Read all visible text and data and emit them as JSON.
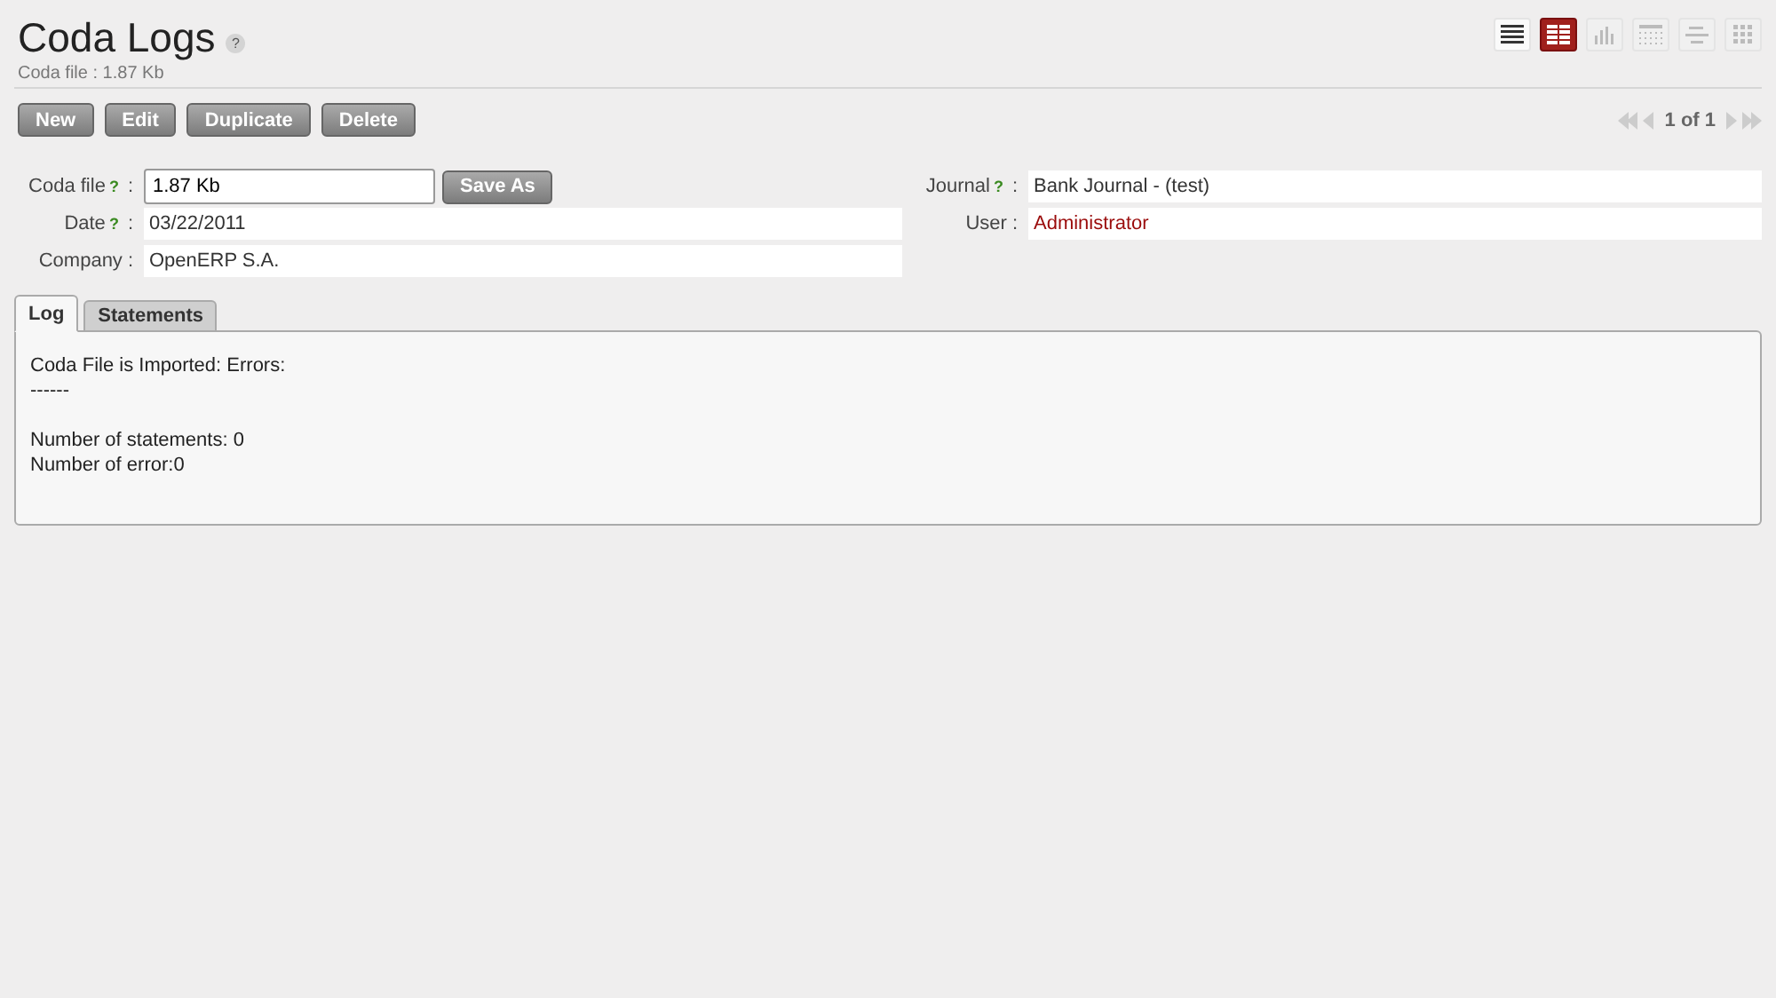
{
  "header": {
    "title": "Coda Logs",
    "help": "?",
    "subtitle": "Coda file : 1.87 Kb"
  },
  "view_switcher": [
    {
      "kind": "list",
      "selected": false
    },
    {
      "kind": "form",
      "selected": true
    },
    {
      "kind": "graph",
      "selected": false
    },
    {
      "kind": "calendar",
      "selected": false
    },
    {
      "kind": "gantt",
      "selected": false
    },
    {
      "kind": "kanban",
      "selected": false
    }
  ],
  "actions": [
    "New",
    "Edit",
    "Duplicate",
    "Delete"
  ],
  "pager": {
    "text": "1 of 1"
  },
  "left_fields": [
    {
      "label": "Coda file",
      "help": "?",
      "colon": ":",
      "kind": "input",
      "value": "1.87 Kb",
      "button": "Save As"
    },
    {
      "label": "Date",
      "help": "?",
      "colon": ":",
      "kind": "text",
      "value": "03/22/2011"
    },
    {
      "label": "Company",
      "colon": ":",
      "kind": "text",
      "value": "OpenERP S.A."
    }
  ],
  "right_fields": [
    {
      "label": "Journal",
      "help": "?",
      "colon": ":",
      "kind": "text",
      "value": "Bank Journal - (test)"
    },
    {
      "label": "User",
      "colon": ":",
      "kind": "link",
      "value": "Administrator"
    }
  ],
  "tabs": [
    {
      "label": "Log",
      "selected": true
    },
    {
      "label": "Statements",
      "selected": false
    }
  ],
  "log": [
    [
      "Coda File is Imported: Errors:",
      "------"
    ],
    [
      "Number of statements: 0",
      "Number of error:0"
    ]
  ]
}
